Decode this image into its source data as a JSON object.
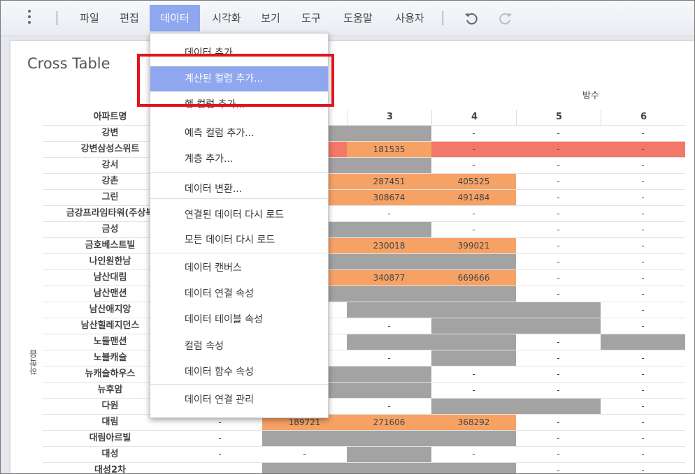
{
  "menubar": {
    "items": [
      "파일",
      "편집",
      "데이터",
      "시각화",
      "보기",
      "도구",
      "도움말",
      "사용자"
    ],
    "active_index": 2
  },
  "content": {
    "title": "Cross Table",
    "column_header_label": "방수",
    "row_header_label": "아파트명",
    "side_label": "하학읍",
    "column_headers": [
      "3",
      "4",
      "5",
      "6"
    ],
    "rows": [
      {
        "name": "강변",
        "cells": [
          "",
          "-",
          "-",
          "-"
        ]
      },
      {
        "name": "강변삼성스위트",
        "cells": [
          "181535",
          "-",
          "-",
          "-"
        ]
      },
      {
        "name": "강서",
        "cells": [
          "",
          "-",
          "-",
          "-"
        ]
      },
      {
        "name": "강촌",
        "cells": [
          "287451",
          "405525",
          "-",
          "-"
        ]
      },
      {
        "name": "그린",
        "cells": [
          "308674",
          "491484",
          "-",
          "-"
        ]
      },
      {
        "name": "금강프라임타워(주상복",
        "cells": [
          "-",
          "-",
          "-",
          "-"
        ]
      },
      {
        "name": "금성",
        "cells": [
          "",
          "-",
          "-",
          "-"
        ]
      },
      {
        "name": "금호베스트빌",
        "cells": [
          "230018",
          "399021",
          "-",
          "-"
        ]
      },
      {
        "name": "나인원한남",
        "cells": [
          "",
          "",
          "-",
          "-"
        ]
      },
      {
        "name": "남산대림",
        "cells": [
          "340877",
          "669666",
          "-",
          "-"
        ]
      },
      {
        "name": "남산맨션",
        "cells": [
          "",
          "",
          "-",
          "-"
        ]
      },
      {
        "name": "남산애지앙",
        "cells": [
          "",
          "",
          "",
          "-"
        ]
      },
      {
        "name": "남산힐레지던스",
        "cells": [
          "-",
          "",
          "",
          "-"
        ]
      },
      {
        "name": "노들맨션",
        "cells": [
          "",
          "",
          "-",
          ""
        ]
      },
      {
        "name": "노블캐슬",
        "cells": [
          "-",
          "",
          "-",
          "-"
        ]
      },
      {
        "name": "뉴캐슬하우스",
        "cells": [
          "",
          "-",
          "-",
          "-"
        ]
      },
      {
        "name": "뉴후암",
        "cells": [
          "",
          "-",
          "-",
          "-"
        ]
      },
      {
        "name": "다원",
        "cells": [
          "-",
          "",
          "",
          "-"
        ]
      },
      {
        "name": "대림",
        "cells": [
          "271606",
          "368292",
          "-",
          "-"
        ]
      },
      {
        "name": "대림아르빌",
        "cells": [
          "",
          "",
          "-",
          "-"
        ]
      },
      {
        "name": "대성",
        "cells": [
          "",
          "-",
          "-",
          "-"
        ]
      },
      {
        "name": "대성2차",
        "cells": [
          "",
          "",
          "-",
          "-"
        ]
      }
    ],
    "extra_cells": {
      "daelim_col1": "-",
      "daelim_col2": "189721",
      "daelimarbil_col1": "-",
      "daesung_col1": "-",
      "daesung_col2": "-"
    }
  },
  "dropdown": {
    "items": [
      "데이터 추가...",
      "계산된 컬럼 추가...",
      "행 컬럼 추가...",
      "예측 컬럼 추가...",
      "계층 추가...",
      "데이터 변환...",
      "연결된 데이터 다시 로드",
      "모든 데이터 다시 로드",
      "데이터 캔버스",
      "데이터 연결 속성",
      "데이터 테이블 속성",
      "컬럼 속성",
      "데이터 함수 속성",
      "데이터 연결 관리"
    ],
    "highlighted_index": 1
  },
  "colors": {
    "accent": "#8fa7ee",
    "gray_cell": "#a3a3a3",
    "orange_cell": "#f7a265",
    "red_cell": "#f47867",
    "annotation_box": "#e0161b"
  }
}
